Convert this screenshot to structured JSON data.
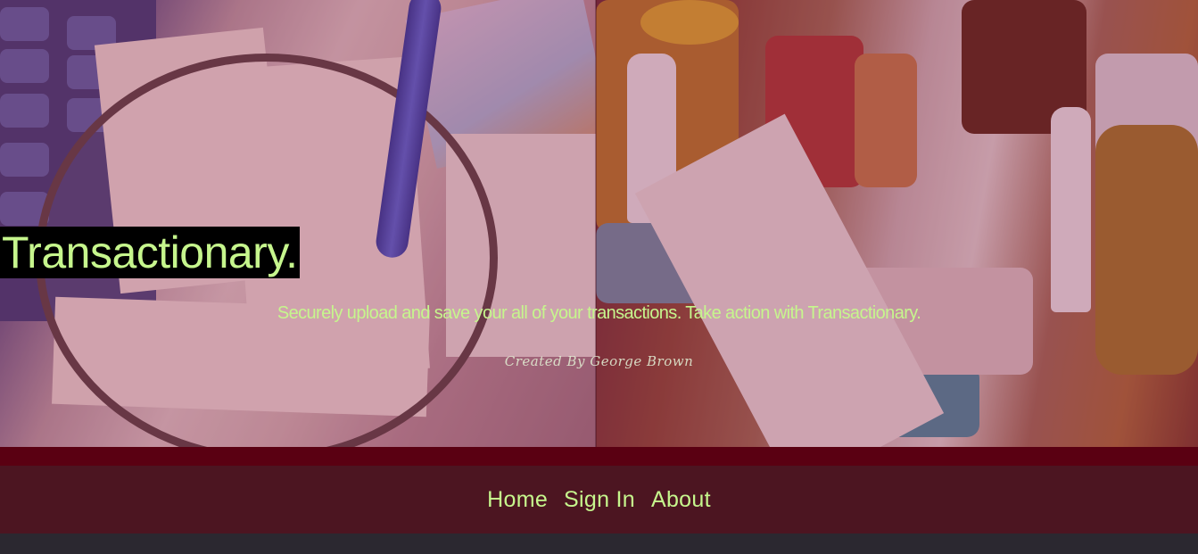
{
  "header": {
    "title": "Transactionary.",
    "tagline": "Securely upload and save your all of your transactions. Take action with Transactionary.",
    "credit": "Created By George Brown"
  },
  "nav": {
    "items": [
      {
        "label": "Home"
      },
      {
        "label": "Sign In"
      },
      {
        "label": "About"
      }
    ]
  },
  "hero": {
    "image_left": "receipts-magnifying-glass-calculator-photo",
    "image_right": "grocery-items-long-receipt-photo"
  },
  "colors": {
    "accent": "#c6f68d",
    "title_bg": "#000000",
    "band": "#5a0012",
    "nav_bg": "#4c1521",
    "footer_bg": "#2b2830",
    "overlay": "#8c143c"
  }
}
